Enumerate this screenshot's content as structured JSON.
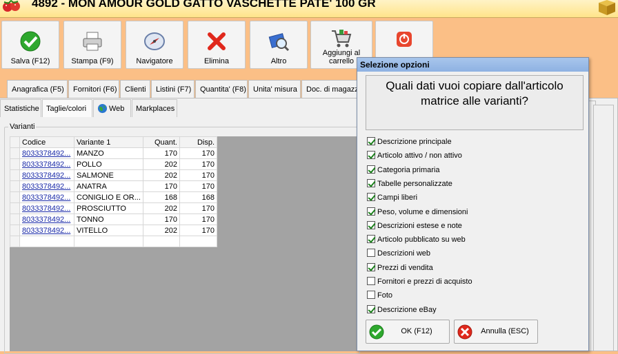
{
  "window": {
    "title": "4892 - MON AMOUR GOLD GATTO VASCHETTE PATE' 100 GR"
  },
  "toolbar": {
    "save": "Salva (F12)",
    "print": "Stampa (F9)",
    "navigator": "Navigatore",
    "delete": "Elimina",
    "other": "Altro",
    "cart_line1": "Aggiungi al",
    "cart_line2": "carrello"
  },
  "tabs": [
    "Anagrafica (F5)",
    "Fornitori (F6)",
    "Clienti",
    "Listini (F7)",
    "Quantita' (F8)",
    "Unita' misura",
    "Doc. di magazzi"
  ],
  "subtabs": [
    "Statistiche",
    "Taglie/colori",
    "Web",
    "Markplaces"
  ],
  "group": {
    "title": "Varianti"
  },
  "grid": {
    "columns": [
      "Codice",
      "Variante 1",
      "Quant.",
      "Disp."
    ],
    "rows": [
      [
        "8033378492...",
        "MANZO",
        "170",
        "170"
      ],
      [
        "8033378492...",
        "POLLO",
        "202",
        "170"
      ],
      [
        "8033378492...",
        "SALMONE",
        "202",
        "170"
      ],
      [
        "8033378492...",
        "ANATRA",
        "170",
        "170"
      ],
      [
        "8033378492...",
        "CONIGLIO E OR...",
        "168",
        "168"
      ],
      [
        "8033378492...",
        "PROSCIUTTO",
        "202",
        "170"
      ],
      [
        "8033378492...",
        "TONNO",
        "170",
        "170"
      ],
      [
        "8033378492...",
        "VITELLO",
        "202",
        "170"
      ]
    ]
  },
  "dialog": {
    "title": "Selezione opzioni",
    "question": "Quali dati vuoi copiare dall'articolo matrice alle varianti?",
    "options": [
      {
        "label": "Descrizione principale",
        "checked": true
      },
      {
        "label": "Articolo attivo / non attivo",
        "checked": true
      },
      {
        "label": "Categoria primaria",
        "checked": true
      },
      {
        "label": "Tabelle personalizzate",
        "checked": true
      },
      {
        "label": "Campi liberi",
        "checked": true
      },
      {
        "label": "Peso, volume e dimensioni",
        "checked": true
      },
      {
        "label": "Descrizioni estese e note",
        "checked": true
      },
      {
        "label": "Articolo pubblicato su web",
        "checked": true
      },
      {
        "label": "Descrizioni web",
        "checked": false
      },
      {
        "label": "Prezzi di vendita",
        "checked": true
      },
      {
        "label": "Fornitori e prezzi di acquisto",
        "checked": false
      },
      {
        "label": "Foto",
        "checked": false
      },
      {
        "label": "Descrizione eBay",
        "checked": true
      }
    ],
    "ok": "OK (F12)",
    "cancel": "Annulla (ESC)"
  }
}
